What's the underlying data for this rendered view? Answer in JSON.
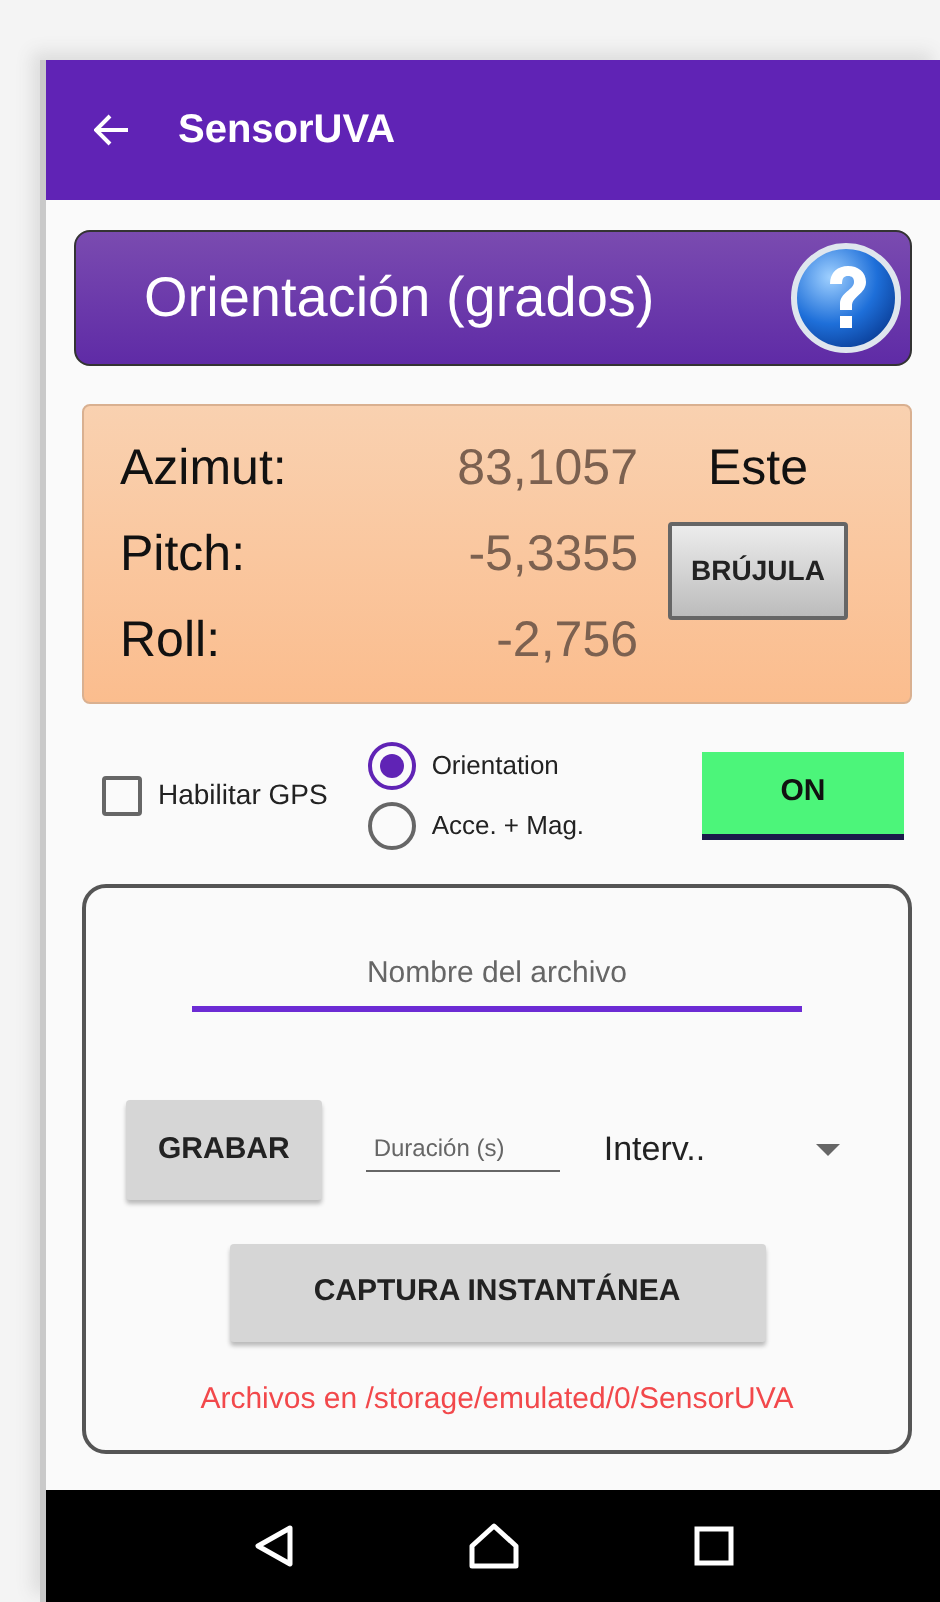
{
  "app_bar": {
    "title": "SensorUVA"
  },
  "header": {
    "title": "Orientación (grados)"
  },
  "readings": [
    {
      "label": "Azimut:",
      "value": "83,1057"
    },
    {
      "label": "Pitch:",
      "value": "-5,3355"
    },
    {
      "label": "Roll:",
      "value": "-2,756"
    }
  ],
  "direction": "Este",
  "compass_button": "BRÚJULA",
  "gps": {
    "label": "Habilitar GPS",
    "checked": false
  },
  "modes": [
    {
      "label": "Orientation",
      "selected": true
    },
    {
      "label": "Acce. + Mag.",
      "selected": false
    }
  ],
  "toggle": {
    "label": "ON",
    "on": true
  },
  "recording": {
    "file_name": {
      "placeholder": "Nombre del archivo"
    },
    "record_button": "GRABAR",
    "duration": {
      "placeholder": "Duración (s)"
    },
    "interval": {
      "value": "Interv.."
    },
    "snapshot_button": "CAPTURA INSTANTÁNEA",
    "path_note": "Archivos en /storage/emulated/0/SensorUVA"
  }
}
